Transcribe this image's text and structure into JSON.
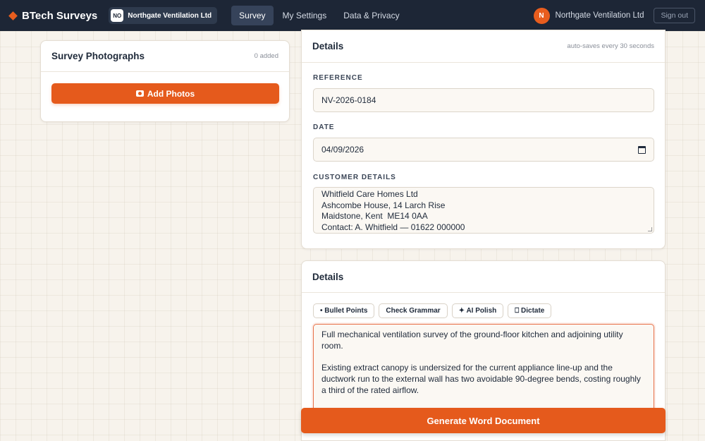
{
  "app": {
    "name": "BTech Surveys",
    "org_badge": "NO",
    "org_name": "Northgate Ventilation Ltd"
  },
  "nav": {
    "items": [
      {
        "label": "Survey",
        "active": true
      },
      {
        "label": "My Settings",
        "active": false
      },
      {
        "label": "Data & Privacy",
        "active": false
      }
    ]
  },
  "user": {
    "initial": "N",
    "name": "Northgate Ventilation Ltd",
    "signout_label": "Sign out"
  },
  "photos": {
    "title": "Survey Photographs",
    "count_text": "0 added",
    "add_label": "Add Photos"
  },
  "details_top": {
    "title": "Details",
    "autosave_text": "auto-saves every 30 seconds",
    "reference_label": "REFERENCE",
    "reference_value": "NV-2026-0184",
    "date_label": "DATE",
    "date_value": "04/09/2026",
    "customer_label": "CUSTOMER DETAILS",
    "customer_value": "Whitfield Care Homes Ltd\nAshcombe House, 14 Larch Rise\nMaidstone, Kent  ME14 0AA\nContact: A. Whitfield — 01622 000000"
  },
  "details_body": {
    "title": "Details",
    "tools": {
      "bullets": "• Bullet Points",
      "grammar": "Check Grammar",
      "polish": "✦ AI Polish",
      "dictate": "⎕ Dictate"
    },
    "paragraph_1": "Full mechanical ventilation survey of the ground-floor kitchen and adjoining utility room.",
    "paragraph_2": "Existing extract canopy is undersized for the current appliance line-up and the ductwork run to the external wall has two avoidable 90-degree bends, costing roughly a third of the rated airflow."
  },
  "generate_label": "Generate Word Document",
  "colors": {
    "accent": "#e55a1c",
    "topbar": "#1d2636"
  }
}
